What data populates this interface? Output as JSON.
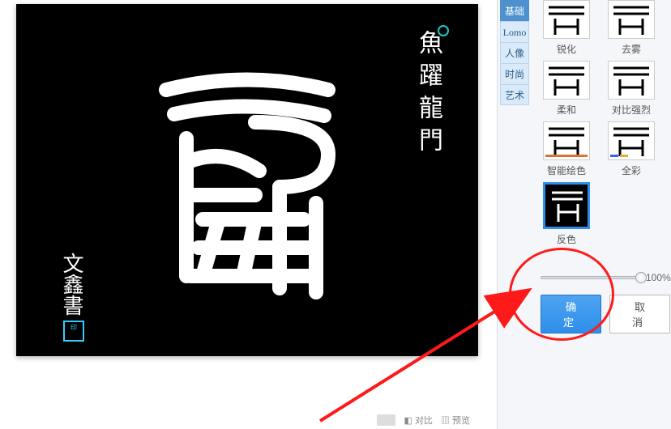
{
  "canvas": {
    "vertical_title": "魚躍龍門",
    "signature": "文鑫書",
    "stamp": "印"
  },
  "categories": [
    {
      "label": "基础",
      "active": true
    },
    {
      "label": "Lomo",
      "active": false
    },
    {
      "label": "人像",
      "active": false
    },
    {
      "label": "时尚",
      "active": false
    },
    {
      "label": "艺术",
      "active": false
    }
  ],
  "effects": {
    "r1c1": "锐化",
    "r1c2": "去雾",
    "r2c1": "柔和",
    "r2c2": "对比强烈",
    "r3c1": "智能绘色",
    "r3c2": "全彩",
    "r4c1": "反色"
  },
  "slider": {
    "percent": "100%"
  },
  "buttons": {
    "ok": "确 定",
    "cancel": "取 消"
  },
  "bottombar": {
    "compare": "对比",
    "preview": "预览"
  }
}
